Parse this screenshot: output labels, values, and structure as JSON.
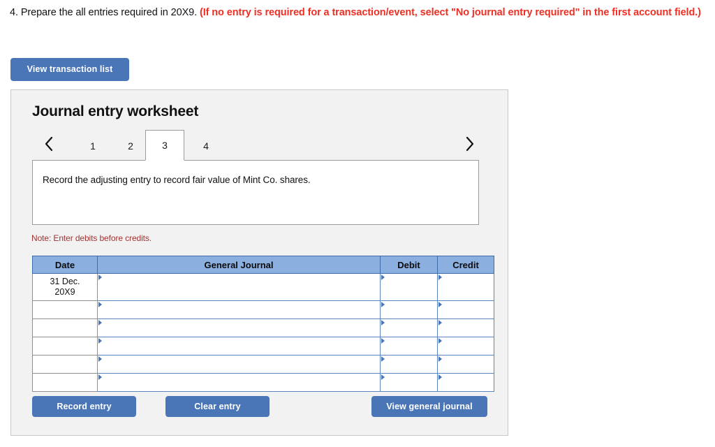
{
  "prompt": {
    "plain_text": "4. Prepare the all entries required in 20X9.",
    "red_text": "(If no entry is required for a transaction/event, select \"No journal entry required\" in the first account field.)",
    "red_color": "#ee2f24"
  },
  "toolbar": {
    "view_transaction_list_label": "View transaction list"
  },
  "worksheet": {
    "title": "Journal entry worksheet",
    "prev_icon": "chevron-left-icon",
    "next_icon": "chevron-right-icon",
    "tabs": [
      {
        "label": "1",
        "active": false
      },
      {
        "label": "2",
        "active": false
      },
      {
        "label": "3",
        "active": true
      },
      {
        "label": "4",
        "active": false
      }
    ],
    "description": "Record the adjusting entry to record fair value of Mint Co. shares.",
    "note": "Note: Enter debits before credits.",
    "note_color": "#a33232"
  },
  "journal_table": {
    "headers": {
      "date": "Date",
      "general_journal": "General Journal",
      "debit": "Debit",
      "credit": "Credit"
    },
    "header_fill": "#8bb0e0",
    "header_border": "#3f6aa8",
    "rows": [
      {
        "date_line1": "31 Dec.",
        "date_line2": "20X9",
        "account": "",
        "debit": "",
        "credit": ""
      },
      {
        "date_line1": "",
        "date_line2": "",
        "account": "",
        "debit": "",
        "credit": ""
      },
      {
        "date_line1": "",
        "date_line2": "",
        "account": "",
        "debit": "",
        "credit": ""
      },
      {
        "date_line1": "",
        "date_line2": "",
        "account": "",
        "debit": "",
        "credit": ""
      },
      {
        "date_line1": "",
        "date_line2": "",
        "account": "",
        "debit": "",
        "credit": ""
      },
      {
        "date_line1": "",
        "date_line2": "",
        "account": "",
        "debit": "",
        "credit": ""
      }
    ]
  },
  "actions": {
    "record_entry_label": "Record entry",
    "clear_entry_label": "Clear entry",
    "view_general_journal_label": "View general journal",
    "button_color": "#4a76b8"
  }
}
